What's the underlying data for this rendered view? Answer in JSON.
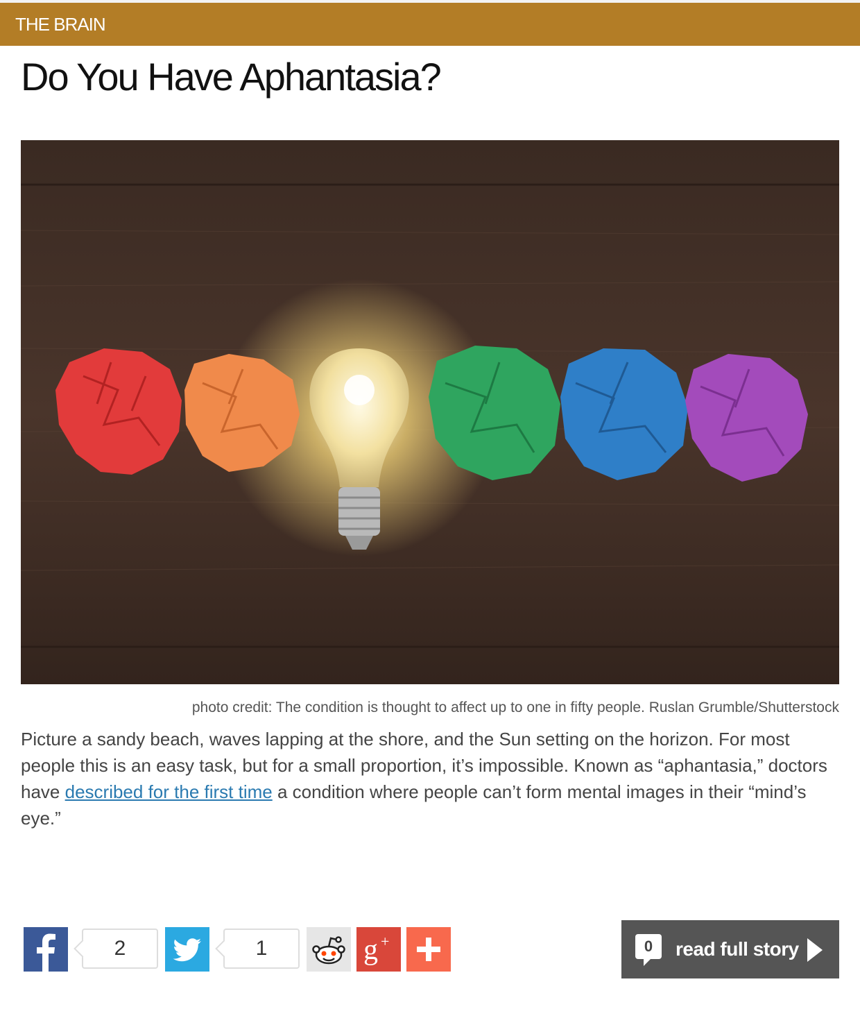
{
  "header": {
    "category": "THE BRAIN",
    "title": "Do You Have Aphantasia?",
    "accent_color": "#b37d26"
  },
  "hero": {
    "image_subject": "crumpled-paper-balls-and-light-bulb",
    "credit": "photo credit: The condition is thought to affect up to one in fifty people. Ruslan Grumble/Shutterstock"
  },
  "article": {
    "text_before_link": "Picture a sandy beach, waves lapping at the shore, and the Sun setting on the horizon. For most people this is an easy task, but for a small proportion, it’s impossible. Known as “aphantasia,” doctors have ",
    "link_text": "described for the first time",
    "text_after_link": " a condition where people can’t form mental images in their “mind’s eye.”"
  },
  "share": {
    "facebook": {
      "icon": "facebook-icon",
      "count": "2",
      "color": "#3b5998"
    },
    "twitter": {
      "icon": "twitter-icon",
      "count": "1",
      "color": "#2ba9e1"
    },
    "reddit": {
      "icon": "reddit-icon",
      "color": "#e6e6e6"
    },
    "googleplus": {
      "icon": "google-plus-icon",
      "label": "g+",
      "color": "#d9473a"
    },
    "more": {
      "icon": "plus-icon",
      "color": "#f8694d"
    }
  },
  "read_more": {
    "comment_count": "0",
    "label": "read full story",
    "color": "#555555"
  }
}
